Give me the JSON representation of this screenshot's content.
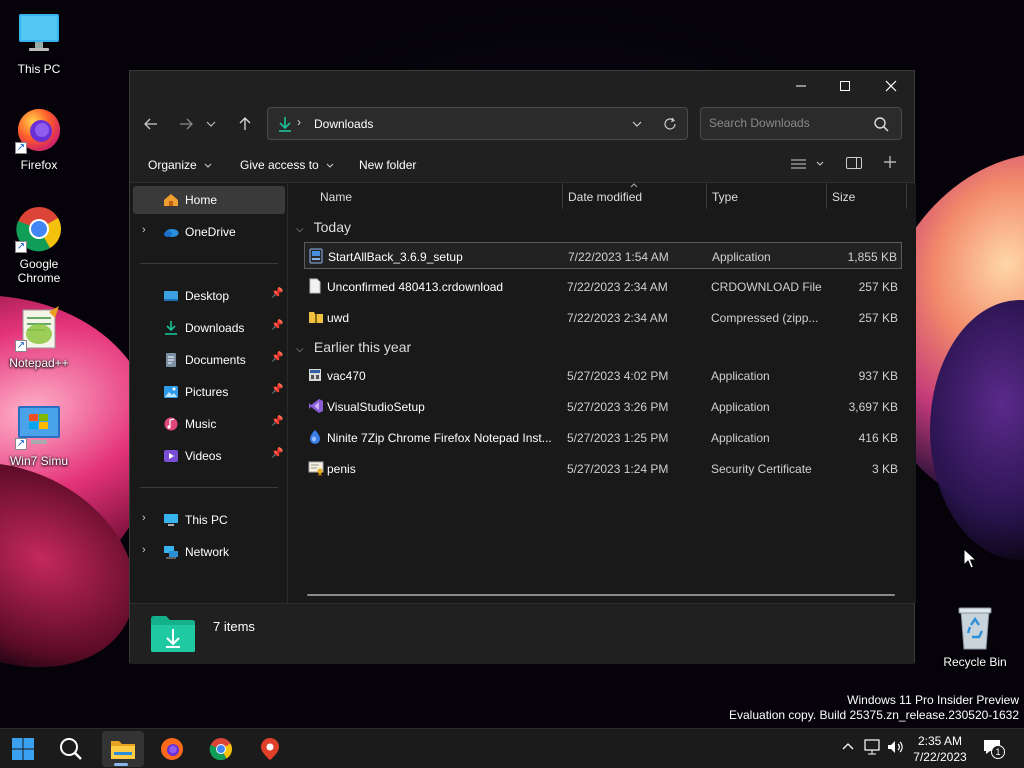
{
  "desktop": {
    "icons": [
      {
        "label": "This PC",
        "icon": "this-pc-icon"
      },
      {
        "label": "Firefox",
        "icon": "firefox-icon"
      },
      {
        "label": "Google Chrome",
        "icon": "chrome-icon"
      },
      {
        "label": "Notepad++",
        "icon": "notepadpp-icon"
      },
      {
        "label": "Win7 Simu",
        "icon": "win7-simu-icon"
      },
      {
        "label": "Recycle Bin",
        "icon": "recycle-bin-icon"
      }
    ],
    "watermark": {
      "line1": "Windows 11 Pro Insider Preview",
      "line2": "Evaluation copy. Build 25375.zn_release.230520-1632"
    }
  },
  "explorer": {
    "address": {
      "location": "Downloads"
    },
    "search": {
      "placeholder": "Search Downloads"
    },
    "commands": {
      "organize": "Organize",
      "give_access": "Give access to",
      "new_folder": "New folder"
    },
    "sidebar": {
      "home": "Home",
      "onedrive": "OneDrive",
      "pinned": [
        {
          "label": "Desktop"
        },
        {
          "label": "Downloads"
        },
        {
          "label": "Documents"
        },
        {
          "label": "Pictures"
        },
        {
          "label": "Music"
        },
        {
          "label": "Videos"
        }
      ],
      "this_pc": "This PC",
      "network": "Network"
    },
    "columns": {
      "name": "Name",
      "date": "Date modified",
      "type": "Type",
      "size": "Size"
    },
    "groups": {
      "today": {
        "label": "Today",
        "rows": [
          {
            "name": "StartAllBack_3.6.9_setup",
            "date": "7/22/2023 1:54 AM",
            "type": "Application",
            "size": "1,855 KB",
            "icon": "installer-icon"
          },
          {
            "name": "Unconfirmed 480413.crdownload",
            "date": "7/22/2023 2:34 AM",
            "type": "CRDOWNLOAD File",
            "size": "257 KB",
            "icon": "file-icon"
          },
          {
            "name": "uwd",
            "date": "7/22/2023 2:34 AM",
            "type": "Compressed (zipp...",
            "size": "257 KB",
            "icon": "zip-folder-icon"
          }
        ]
      },
      "earlier": {
        "label": "Earlier this year",
        "rows": [
          {
            "name": "vac470",
            "date": "5/27/2023 4:02 PM",
            "type": "Application",
            "size": "937 KB",
            "icon": "app-icon"
          },
          {
            "name": "VisualStudioSetup",
            "date": "5/27/2023 3:26 PM",
            "type": "Application",
            "size": "3,697 KB",
            "icon": "visual-studio-icon"
          },
          {
            "name": "Ninite 7Zip Chrome Firefox Notepad Inst...",
            "date": "5/27/2023 1:25 PM",
            "type": "Application",
            "size": "416 KB",
            "icon": "ninite-icon"
          },
          {
            "name": "penis",
            "date": "5/27/2023 1:24 PM",
            "type": "Security Certificate",
            "size": "3 KB",
            "icon": "certificate-icon"
          }
        ]
      }
    },
    "status": {
      "count": "7 items"
    }
  },
  "taskbar": {
    "clock": {
      "time": "2:35 AM",
      "date": "7/22/2023"
    },
    "notification_count": "1"
  },
  "colors": {
    "accent": "#0f9d8a",
    "selection": "#3a3a3a",
    "window_bg": "#191919",
    "chrome_bg": "#202020"
  }
}
